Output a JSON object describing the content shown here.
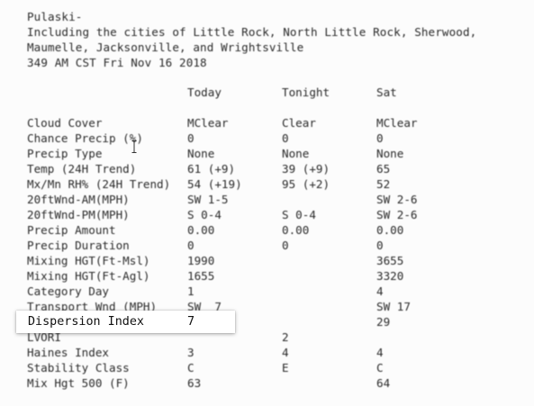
{
  "header": {
    "location": "Pulaski-",
    "cities_line1": "Including the cities of Little Rock, North Little Rock, Sherwood,",
    "cities_line2": "Maumelle, Jacksonville, and Wrightsville",
    "issued": "349 AM CST Fri Nov 16 2018"
  },
  "columns": [
    "Today",
    "Tonight",
    "Sat"
  ],
  "rows": [
    {
      "label": "Cloud Cover",
      "today": "MClear",
      "tonight": "Clear",
      "sat": "MClear"
    },
    {
      "label": "Chance Precip (%)",
      "today": "0",
      "tonight": "0",
      "sat": "0"
    },
    {
      "label": "Precip Type",
      "today": "None",
      "tonight": "None",
      "sat": "None"
    },
    {
      "label": "Temp (24H Trend)",
      "today": "61 (+9)",
      "tonight": "39 (+9)",
      "sat": "65"
    },
    {
      "label": "Mx/Mn RH% (24H Trend)",
      "today": "54 (+19)",
      "tonight": "95 (+2)",
      "sat": "52"
    },
    {
      "label": "20ftWnd-AM(MPH)",
      "today": "SW 1-5",
      "tonight": "",
      "sat": "SW 2-6"
    },
    {
      "label": "20ftWnd-PM(MPH)",
      "today": "S 0-4",
      "tonight": "S 0-4",
      "sat": "SW 2-6"
    },
    {
      "label": "Precip Amount",
      "today": "0.00",
      "tonight": "0.00",
      "sat": "0.00"
    },
    {
      "label": "Precip Duration",
      "today": "0",
      "tonight": "0",
      "sat": "0"
    },
    {
      "label": "Mixing HGT(Ft-Msl)",
      "today": "1990",
      "tonight": "",
      "sat": "3655"
    },
    {
      "label": "Mixing HGT(Ft-Agl)",
      "today": "1655",
      "tonight": "",
      "sat": "3320"
    },
    {
      "label": "Category Day",
      "today": "1",
      "tonight": "",
      "sat": "4"
    },
    {
      "label": "Transport Wnd (MPH)",
      "today": "SW  7",
      "tonight": "",
      "sat": "SW 17"
    },
    {
      "label": "",
      "today": "",
      "tonight": "",
      "sat": "29"
    },
    {
      "label": "LVORI",
      "today": "",
      "tonight": "2",
      "sat": ""
    },
    {
      "label": "Haines Index",
      "today": "3",
      "tonight": "4",
      "sat": "4"
    },
    {
      "label": "Stability Class",
      "today": "C",
      "tonight": "E",
      "sat": "C"
    },
    {
      "label": "Mix Hgt 500 (F)",
      "today": "63",
      "tonight": "",
      "sat": "64"
    }
  ],
  "highlight": {
    "label": "Dispersion Index",
    "value": "7"
  },
  "cursor_icon": "text-cursor-icon"
}
